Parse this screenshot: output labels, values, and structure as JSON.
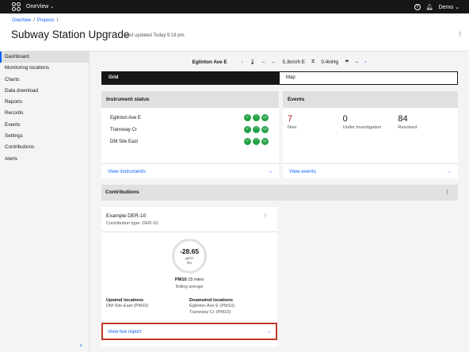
{
  "app": {
    "name": "OneView",
    "user": "Demo"
  },
  "breadcrumb": {
    "home": "OneView",
    "projects": "Projects"
  },
  "page": {
    "title": "Subway Station Upgrade",
    "updated": "Last updated Today 9:18 pm"
  },
  "sidebar": {
    "items": [
      {
        "label": "Dashboard",
        "active": true
      },
      {
        "label": "Monitoring locations"
      },
      {
        "label": "Charts"
      },
      {
        "label": "Data download"
      },
      {
        "label": "Reports"
      },
      {
        "label": "Records"
      },
      {
        "label": "Events"
      },
      {
        "label": "Settings"
      },
      {
        "label": "Contributions"
      },
      {
        "label": "Alerts"
      }
    ]
  },
  "location_bar": {
    "name": "Eglinton Ave E",
    "temp": "–",
    "wind": "5.3km/h E",
    "pressure": "0.4inHg",
    "rain": "–"
  },
  "tabs": {
    "grid": "Grid",
    "map": "Map"
  },
  "instrument_status": {
    "title": "Instrument status",
    "rows": [
      "Eglinton Ave E",
      "Transway Cr",
      "DM Site East"
    ],
    "link": "View instruments"
  },
  "events": {
    "title": "Events",
    "stats": [
      {
        "value": "7",
        "label": "New"
      },
      {
        "value": "0",
        "label": "Under investigation"
      },
      {
        "value": "84",
        "label": "Resolved"
      }
    ],
    "link": "View events"
  },
  "contributions": {
    "title": "Contributions",
    "card": {
      "title": "Example DER-10",
      "subtitle": "Contribution type: DER-10",
      "value": "-28.65",
      "unit": "µg/m³",
      "pct": "0%",
      "pm": "PM10",
      "interval": "15 mins",
      "rolling": "Rolling average",
      "upwind_label": "Upwind locations",
      "upwind_values": [
        "DM Site East (PM10)"
      ],
      "downwind_label": "Downwind locations",
      "downwind_values": [
        "Eglinton Ave E (PM10)",
        "Transway Cr (PM10)"
      ],
      "link": "View live report"
    }
  },
  "colors": {
    "accent": "#0f62fe",
    "ok": "#24a148",
    "highlight": "#c0392b",
    "new_events": "#a2191f"
  }
}
